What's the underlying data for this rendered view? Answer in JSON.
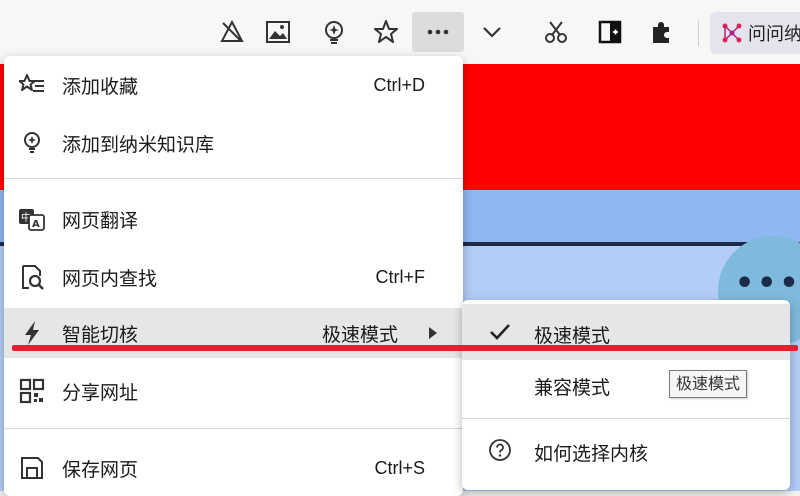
{
  "toolbar": {
    "icons": [
      "no-tracking-icon",
      "image-icon",
      "nami-icon",
      "star-icon",
      "more-icon",
      "chevron-down-icon",
      "scissors-icon",
      "sidebar-icon",
      "extensions-icon"
    ],
    "profile_label": "问问纳"
  },
  "menu": {
    "items": [
      {
        "label": "添加收藏",
        "shortcut": "Ctrl+D",
        "icon": "star-list-icon"
      },
      {
        "label": "添加到纳米知识库",
        "shortcut": "",
        "icon": "bulb-icon"
      },
      {
        "label": "网页翻译",
        "shortcut": "",
        "icon": "translate-icon"
      },
      {
        "label": "网页内查找",
        "shortcut": "Ctrl+F",
        "icon": "find-page-icon"
      },
      {
        "label": "智能切核",
        "value": "极速模式",
        "icon": "lightning-icon"
      },
      {
        "label": "分享网址",
        "shortcut": "",
        "icon": "qrcode-icon"
      },
      {
        "label": "保存网页",
        "shortcut": "Ctrl+S",
        "icon": "save-page-icon"
      }
    ]
  },
  "submenu": {
    "items": [
      {
        "label": "极速模式",
        "checked": true,
        "icon": "check-icon"
      },
      {
        "label": "兼容模式",
        "checked": false
      },
      {
        "label": "如何选择内核",
        "icon": "question-circle-icon"
      }
    ],
    "tooltip": "极速模式"
  },
  "colors": {
    "annotation": "#e51f2e",
    "page_red": "#ff0000",
    "page_blue": "#a9c7f5"
  }
}
